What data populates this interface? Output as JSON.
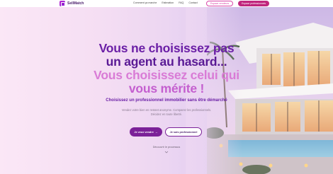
{
  "header": {
    "brand": "SellMatch",
    "nav": [
      "Comment ça marche",
      "Estimation",
      "FAQ",
      "Contact"
    ],
    "seller_space": "Espace vendeurs",
    "pro_space": "Espace professionnels"
  },
  "hero": {
    "title_line1": "Vous ne choisissez pas",
    "title_line2": "un agent au hasard...",
    "title_line3": "Vous choisissez celui qui",
    "title_line4": "vous mérite !",
    "subtitle": "Choisissez un professionnel immobilier sans être démarché",
    "description": "Vendez votre bien en restant anonyme. Comparez les professionnels. Décidez en toute liberté.",
    "primary_cta": "Je veux vendre",
    "secondary_cta": "Je suis professionnel",
    "discover": "Découvrir le processus"
  },
  "colors": {
    "brand_purple": "#6b1fa6",
    "accent_pink": "#d946a8",
    "cta_purple": "#7b2198"
  }
}
